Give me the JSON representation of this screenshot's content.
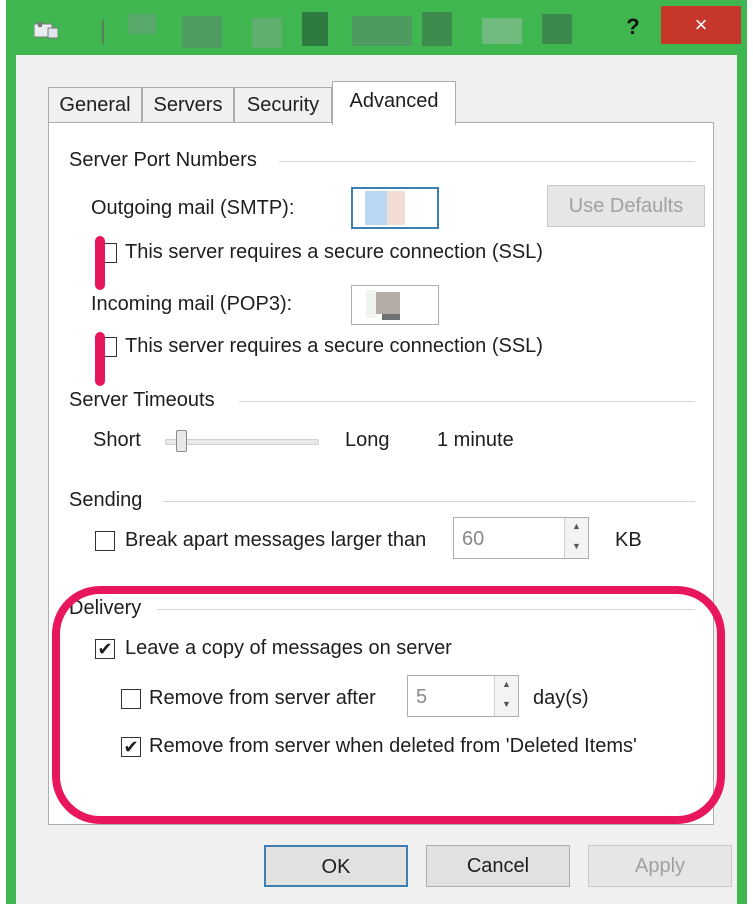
{
  "window": {
    "help_label": "?",
    "close_label": "×",
    "accent_color": "#3fb64f",
    "icons": {
      "app": "app-icon",
      "help": "help-icon",
      "close": "close-icon"
    }
  },
  "tabs": [
    {
      "label": "General",
      "active": false
    },
    {
      "label": "Servers",
      "active": false
    },
    {
      "label": "Security",
      "active": false
    },
    {
      "label": "Advanced",
      "active": true
    }
  ],
  "server_ports": {
    "heading": "Server Port Numbers",
    "outgoing_label": "Outgoing mail (SMTP):",
    "use_defaults_label": "Use Defaults",
    "ssl_label_1": "This server requires a secure connection (SSL)",
    "incoming_label": "Incoming mail (POP3):",
    "ssl_label_2": "This server requires a secure connection (SSL)"
  },
  "timeouts": {
    "heading": "Server Timeouts",
    "short_label": "Short",
    "long_label": "Long",
    "value_label": "1 minute",
    "slider_level": 0.08
  },
  "sending": {
    "heading": "Sending",
    "break_label": "Break apart messages larger than",
    "break_checked": false,
    "size_value": "60",
    "unit_label": "KB"
  },
  "delivery": {
    "heading": "Delivery",
    "leave_copy_label": "Leave a copy of messages on server",
    "leave_copy_checked": true,
    "remove_after_label": "Remove from server after",
    "remove_after_checked": false,
    "days_value": "5",
    "days_unit": "day(s)",
    "remove_deleted_label": "Remove from server when deleted from 'Deleted Items'",
    "remove_deleted_checked": true
  },
  "buttons": {
    "ok": "OK",
    "cancel": "Cancel",
    "apply": "Apply"
  },
  "annotation_color": "#e8175d",
  "check_glyph": "✔"
}
